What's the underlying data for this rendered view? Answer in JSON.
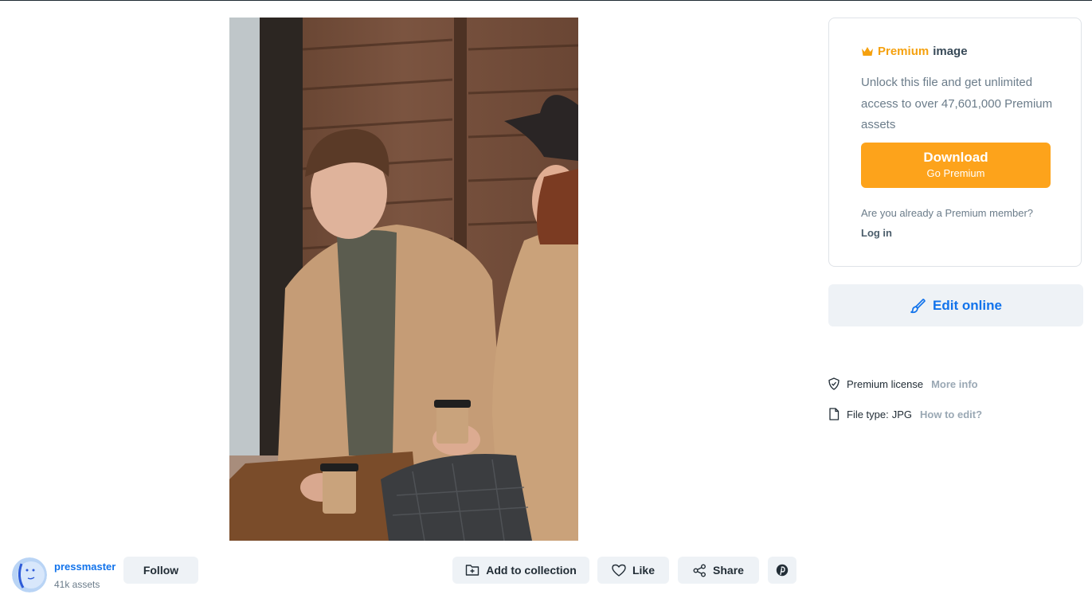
{
  "premium": {
    "premium_word": "Premium",
    "image_word": "image",
    "description": "Unlock this file and get unlimited access to over 47,601,000 Premium assets",
    "download_label": "Download",
    "download_sub": "Go Premium",
    "already_member": "Are you already a Premium member?",
    "login_label": "Log in",
    "accent_color": "#fda31b"
  },
  "edit_online": {
    "label": "Edit online",
    "color": "#1273eb"
  },
  "meta": {
    "license_label": "Premium license",
    "license_link": "More info",
    "filetype_label": "File type:",
    "filetype_value": "JPG",
    "filetype_link": "How to edit?"
  },
  "author": {
    "name": "pressmaster",
    "assets": "41k assets",
    "follow_label": "Follow"
  },
  "actions": {
    "collection_label": "Add to collection",
    "like_label": "Like",
    "share_label": "Share"
  },
  "icons": [
    "crown-icon",
    "brush-icon",
    "shield-icon",
    "file-icon",
    "folder-plus-icon",
    "heart-icon",
    "share-icon",
    "pinterest-icon"
  ]
}
